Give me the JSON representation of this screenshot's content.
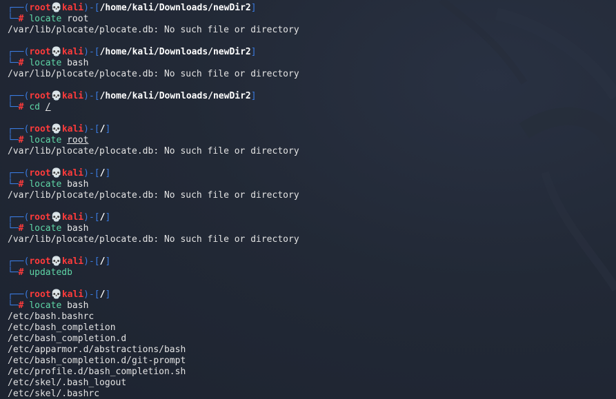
{
  "terminal": {
    "blocks": [
      {
        "user": "root",
        "skull": "💀",
        "host": "kali",
        "path": "/home/kali/Downloads/newDir2",
        "command": "locate",
        "arg": "root",
        "output": [
          "/var/lib/plocate/plocate.db: No such file or directory"
        ]
      },
      {
        "user": "root",
        "skull": "💀",
        "host": "kali",
        "path": "/home/kali/Downloads/newDir2",
        "command": "locate",
        "arg": "bash",
        "output": [
          "/var/lib/plocate/plocate.db: No such file or directory"
        ]
      },
      {
        "user": "root",
        "skull": "💀",
        "host": "kali",
        "path": "/home/kali/Downloads/newDir2",
        "command": "cd",
        "arg": "/",
        "output": []
      },
      {
        "user": "root",
        "skull": "💀",
        "host": "kali",
        "path": "/",
        "command": "locate",
        "arg": "root",
        "output": [
          "/var/lib/plocate/plocate.db: No such file or directory"
        ]
      },
      {
        "user": "root",
        "skull": "💀",
        "host": "kali",
        "path": "/",
        "command": "locate",
        "arg": "bash",
        "output": [
          "/var/lib/plocate/plocate.db: No such file or directory"
        ]
      },
      {
        "user": "root",
        "skull": "💀",
        "host": "kali",
        "path": "/",
        "command": "locate",
        "arg": "bash",
        "output": [
          "/var/lib/plocate/plocate.db: No such file or directory"
        ]
      },
      {
        "user": "root",
        "skull": "💀",
        "host": "kali",
        "path": "/",
        "command": "updatedb",
        "arg": "",
        "output": []
      },
      {
        "user": "root",
        "skull": "💀",
        "host": "kali",
        "path": "/",
        "command": "locate",
        "arg": "bash",
        "output": [
          "/etc/bash.bashrc",
          "/etc/bash_completion",
          "/etc/bash_completion.d",
          "/etc/apparmor.d/abstractions/bash",
          "/etc/bash_completion.d/git-prompt",
          "/etc/profile.d/bash_completion.sh",
          "/etc/skel/.bash_logout",
          "/etc/skel/.bashrc"
        ]
      }
    ]
  },
  "colors": {
    "background": "#1f2430",
    "prompt_frame": "#3a7be0",
    "user_host": "#ff3b3b",
    "command_valid": "#5fd7a7",
    "command_default": "#7fb8ff",
    "output_text": "#e3e3e3"
  }
}
